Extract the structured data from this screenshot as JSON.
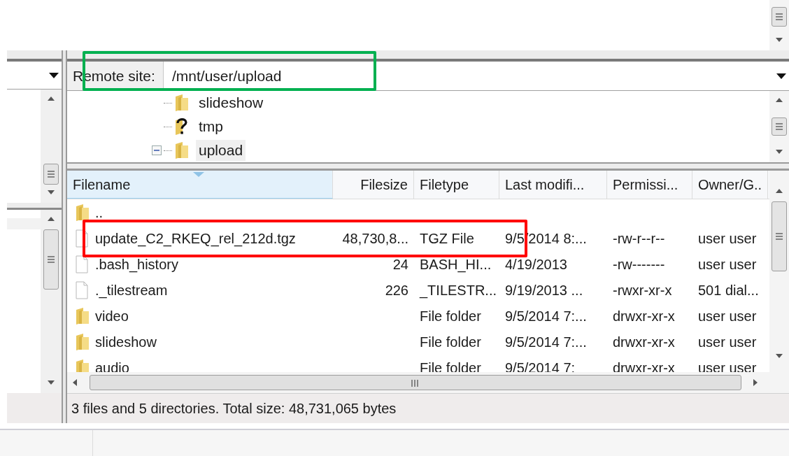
{
  "remote_site": {
    "label": "Remote site:",
    "path": "/mnt/user/upload"
  },
  "tree": [
    {
      "name": "slideshow",
      "kind": "folder",
      "selected": false
    },
    {
      "name": "tmp",
      "kind": "unknown",
      "selected": false
    },
    {
      "name": "upload",
      "kind": "folder",
      "selected": true,
      "expanded": true
    }
  ],
  "file_list": {
    "columns": [
      {
        "label": "Filename",
        "sorted": true
      },
      {
        "label": "Filesize",
        "sorted": false
      },
      {
        "label": "Filetype",
        "sorted": false
      },
      {
        "label": "Last modifi...",
        "sorted": false
      },
      {
        "label": "Permissi...",
        "sorted": false
      },
      {
        "label": "Owner/G..",
        "sorted": false
      }
    ],
    "rows": [
      {
        "kind": "folder",
        "cells": [
          ".."
        ]
      },
      {
        "kind": "file",
        "cells": [
          "update_C2_RKEQ_rel_212d.tgz",
          "48,730,8...",
          "TGZ File",
          "9/5/2014 8:...",
          "-rw-r--r--",
          "user user"
        ]
      },
      {
        "kind": "file",
        "cells": [
          ".bash_history",
          "24",
          "BASH_HI...",
          "4/19/2013",
          "-rw-------",
          "user user"
        ]
      },
      {
        "kind": "file",
        "cells": [
          "._tilestream",
          "226",
          "_TILESTR...",
          "9/19/2013 ...",
          "-rwxr-xr-x",
          "501 dial..."
        ]
      },
      {
        "kind": "folder",
        "cells": [
          "video",
          "",
          "File folder",
          "9/5/2014 7:...",
          "drwxr-xr-x",
          "user user"
        ]
      },
      {
        "kind": "folder",
        "cells": [
          "slideshow",
          "",
          "File folder",
          "9/5/2014 7:...",
          "drwxr-xr-x",
          "user user"
        ]
      },
      {
        "kind": "folder",
        "cells": [
          "audio",
          "",
          "File folder",
          "9/5/2014 7:",
          "drwxr-xr-x",
          "user user"
        ]
      }
    ]
  },
  "status_bar": "3 files and 5 directories. Total size: 48,731,065 bytes",
  "annotations": [
    {
      "kind": "box",
      "color": "#00b050"
    },
    {
      "kind": "box",
      "color": "#ff0000"
    }
  ]
}
